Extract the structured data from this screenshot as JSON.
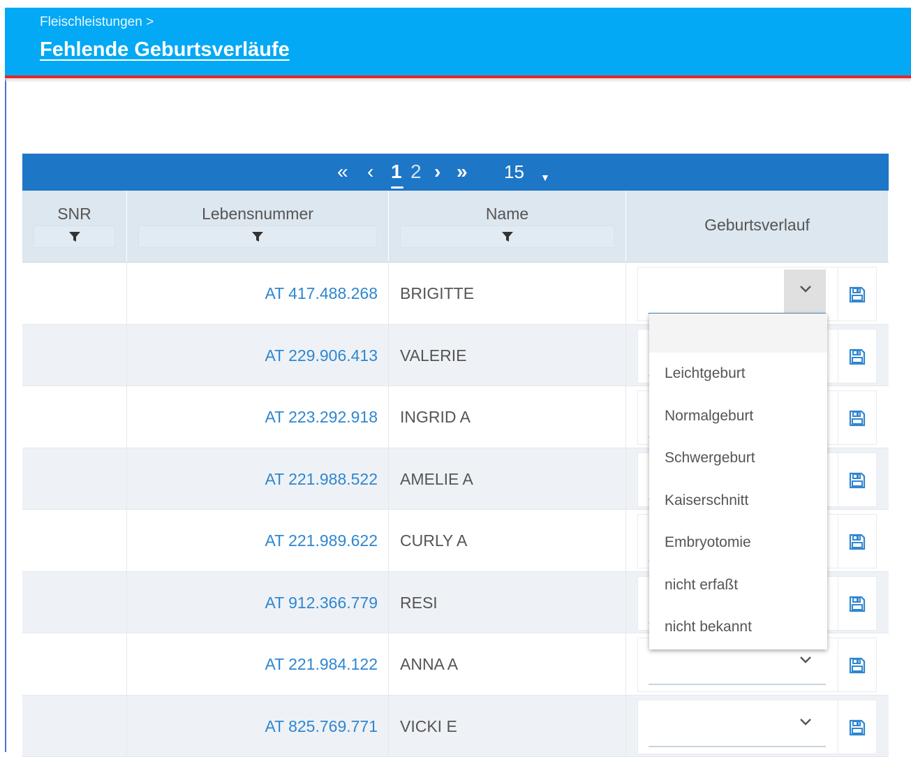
{
  "header": {
    "breadcrumb": "Fleischleistungen >",
    "title": "Fehlende Geburtsverläufe"
  },
  "pager": {
    "first": "«",
    "prev": "‹",
    "pages": [
      "1",
      "2"
    ],
    "current_page": "1",
    "next": "›",
    "last": "»",
    "page_size": "15",
    "page_size_caret": "▼"
  },
  "columns": {
    "snr": "SNR",
    "lebensnummer": "Lebensnummer",
    "name": "Name",
    "geburtsverlauf": "Geburtsverlauf"
  },
  "rows": [
    {
      "snr": "",
      "lebensnummer": "AT 417.488.268",
      "name": "BRIGITTE",
      "geburtsverlauf": ""
    },
    {
      "snr": "",
      "lebensnummer": "AT 229.906.413",
      "name": "VALERIE",
      "geburtsverlauf": ""
    },
    {
      "snr": "",
      "lebensnummer": "AT 223.292.918",
      "name": "INGRID A",
      "geburtsverlauf": ""
    },
    {
      "snr": "",
      "lebensnummer": "AT 221.988.522",
      "name": "AMELIE A",
      "geburtsverlauf": ""
    },
    {
      "snr": "",
      "lebensnummer": "AT 221.989.622",
      "name": "CURLY A",
      "geburtsverlauf": ""
    },
    {
      "snr": "",
      "lebensnummer": "AT 912.366.779",
      "name": "RESI",
      "geburtsverlauf": ""
    },
    {
      "snr": "",
      "lebensnummer": "AT 221.984.122",
      "name": "ANNA A",
      "geburtsverlauf": ""
    },
    {
      "snr": "",
      "lebensnummer": "AT 825.769.771",
      "name": "VICKI E",
      "geburtsverlauf": ""
    }
  ],
  "dropdown_options": [
    "",
    "Leichtgeburt",
    "Normalgeburt",
    "Schwergeburt",
    "Kaiserschnitt",
    "Embryotomie",
    "nicht erfaßt",
    "nicht bekannt"
  ],
  "icons": {
    "filter": "filter-icon",
    "save": "save-icon",
    "chevron": "chevron-down-icon"
  },
  "colors": {
    "header_bg": "#03a9f4",
    "header_border": "#e0282d",
    "pager_bg": "#1e76c6",
    "link": "#2f86d0"
  }
}
